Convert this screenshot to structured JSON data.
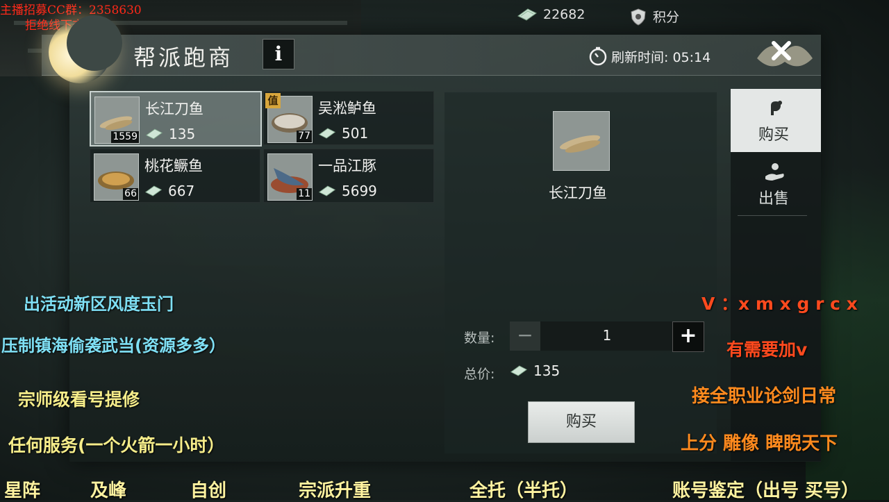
{
  "watermark": {
    "line1": "主播招募CC群：2358630",
    "line2": "拒绝线下交易"
  },
  "currency": {
    "silver": "22682",
    "points_label": "积分"
  },
  "panel": {
    "title": "帮派跑商",
    "info_label": "i",
    "refresh_label": "刷新时间: 05:14",
    "close_icon": "close-icon"
  },
  "items": [
    {
      "name": "长江刀鱼",
      "price": "135",
      "count": "1559",
      "tag": "",
      "selected": true
    },
    {
      "name": "吴淞鲈鱼",
      "price": "501",
      "count": "77",
      "tag": "值",
      "selected": false
    },
    {
      "name": "桃花鳜鱼",
      "price": "667",
      "count": "66",
      "tag": "",
      "selected": false
    },
    {
      "name": "一品江豚",
      "price": "5699",
      "count": "11",
      "tag": "",
      "selected": false
    }
  ],
  "detail": {
    "name": "长江刀鱼",
    "quantity_label": "数量:",
    "quantity_value": "1",
    "minus_label": "−",
    "plus_label": "+",
    "total_label": "总价:",
    "total_value": "135",
    "buy_button": "购买"
  },
  "tabs": {
    "buy": "购买",
    "sell": "出售"
  },
  "overlay": {
    "left": [
      "出活动新区风度玉门",
      "压制镇海偷袭武当(资源多多）",
      "宗师级看号提修",
      "任何服务(一个火箭一小时）"
    ],
    "right": [
      "V ：x m x g r c x",
      "有需要加v",
      "接全职业论剑日常",
      "上分   雕像  睥睨天下"
    ],
    "bottom": [
      "星阵",
      "及峰",
      "自创",
      "宗派升重",
      "全托（半托）",
      "账号鉴定（出号 买号）"
    ]
  },
  "colors": {
    "accent_tag": "#d8a63c",
    "overlay_cyan": "#7fe0f5",
    "overlay_yellow": "#f6ed8a",
    "overlay_red": "#ff4a1e"
  }
}
